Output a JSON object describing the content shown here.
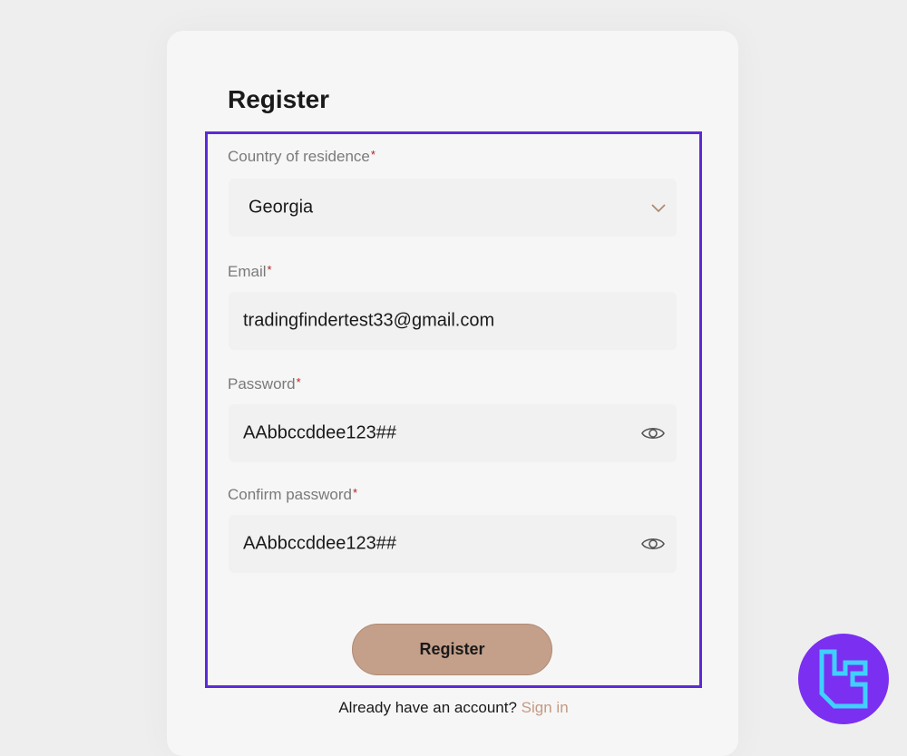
{
  "form": {
    "title": "Register",
    "country": {
      "label": "Country of residence",
      "value": "Georgia"
    },
    "email": {
      "label": "Email",
      "value": "tradingfindertest33@gmail.com"
    },
    "password": {
      "label": "Password",
      "value": "AAbbccddee123##"
    },
    "confirm_password": {
      "label": "Confirm password",
      "value": "AAbbccddee123##"
    },
    "required_mark": "*",
    "register_button": "Register"
  },
  "footer": {
    "prompt": "Already have an account?",
    "signin_link": "Sign in"
  },
  "colors": {
    "accent": "#c4a08a",
    "highlight_border": "#5b2bd6",
    "required": "#b32020",
    "logo_bg": "#7b2ff0",
    "logo_stroke": "#3fd0ff"
  },
  "icons": {
    "country_dropdown": "chevron-down-icon",
    "password_toggle": "eye-icon",
    "confirm_password_toggle": "eye-icon",
    "watermark": "tradingfinder-logo-icon"
  }
}
